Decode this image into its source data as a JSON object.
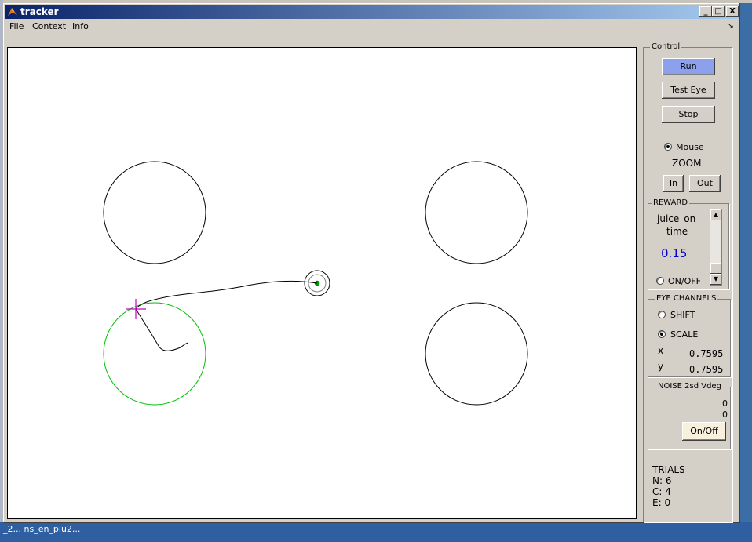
{
  "window": {
    "title": "tracker",
    "controls": [
      "_",
      "□",
      "X"
    ]
  },
  "menu": {
    "items": [
      "File",
      "Context",
      "Info"
    ],
    "overflow": "↘"
  },
  "colors": {
    "target_active": "#00c000",
    "cursor": "#cc00cc",
    "run_button": "#8da0ec",
    "value_text": "#0000cc"
  },
  "control": {
    "title": "Control",
    "run": "Run",
    "test_eye": "Test Eye",
    "stop": "Stop",
    "mouse_label": "Mouse",
    "zoom_label": "ZOOM",
    "zoom_in": "In",
    "zoom_out": "Out"
  },
  "reward": {
    "title": "REWARD",
    "line1": "juice_on",
    "line2": "time",
    "value": "0.15",
    "onoff": "ON/OFF"
  },
  "eye_channels": {
    "title": "EYE CHANNELS",
    "shift": "SHIFT",
    "scale": "SCALE",
    "x_label": "x",
    "x_value": "0.7595",
    "y_label": "y",
    "y_value": "0.7595"
  },
  "noise": {
    "title": "NOISE 2sd Vdeg",
    "v1": "0",
    "v2": "0",
    "button": "On/Off"
  },
  "trials": {
    "title": "TRIALS",
    "n": "N: 6",
    "c": "C: 4",
    "e": "E: 0"
  },
  "taskbar": {
    "text": "_2...   ns_en_plu2..."
  }
}
